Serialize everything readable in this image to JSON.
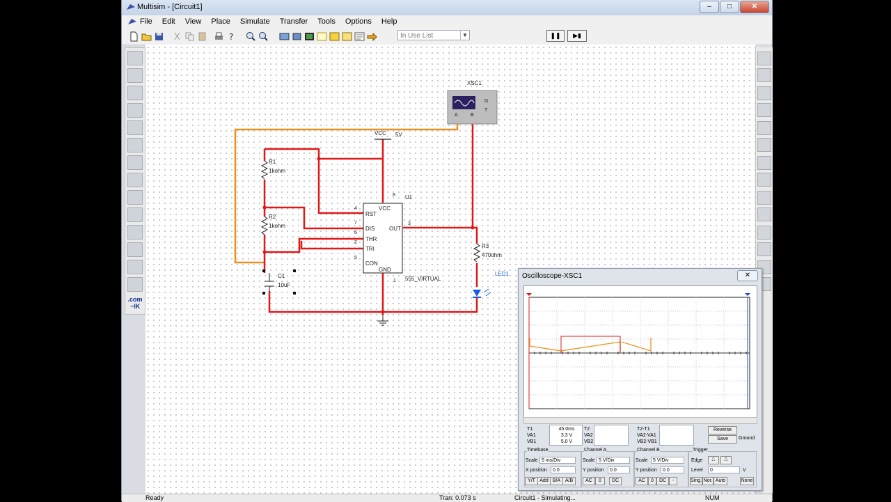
{
  "window": {
    "title": "Multisim - [Circuit1]",
    "buttons": [
      "–",
      "□",
      "✕"
    ]
  },
  "menu": [
    "File",
    "Edit",
    "View",
    "Place",
    "Simulate",
    "Transfer",
    "Tools",
    "Options",
    "Help"
  ],
  "toolbar": {
    "in_use_list": "In Use List"
  },
  "canvas": {
    "labels": {
      "xsc1": "XSC1",
      "vcc": "VCC",
      "vcc_val": "5V",
      "r1": "R1",
      "r1_val": "1kohm",
      "r2": "R2",
      "r2_val": "1kohm",
      "r3": "R3",
      "r3_val": "470ohm",
      "c1": "C1",
      "c1_val": "10uF",
      "u1": "U1",
      "u1_part": "555_VIRTUAL",
      "led1": "LED1",
      "pin_rst": "RST",
      "pin_dis": "DIS",
      "pin_thr": "THR",
      "pin_tri": "TRI",
      "pin_con": "CON",
      "pin_vcc": "VCC",
      "pin_out": "OUT",
      "pin_gnd": "GND",
      "pin4": "4",
      "pin7": "7",
      "pin6": "6",
      "pin2": "2",
      "pin5": "5",
      "pin8": "8",
      "pin3": "3",
      "pin1": "1",
      "scope_a": "A",
      "scope_b": "B",
      "scope_g": "G",
      "scope_t": "T"
    }
  },
  "oscilloscope": {
    "title": "Oscilloscope-XSC1",
    "close": "✕",
    "readout": {
      "t1": "T1",
      "va1": "VA1",
      "vb1": "VB1",
      "t1_time": "45.0ms",
      "t1_va": "3.3 V",
      "t1_vb": "5.0 V",
      "t2": "T2",
      "va2": "VA2",
      "vb2": "VB2",
      "t2t1": "T2-T1",
      "va2va1": "VA2-VA1",
      "vb2vb1": "VB2-VB1",
      "reverse": "Reverse",
      "save": "Save",
      "ground": "Ground"
    },
    "timebase": {
      "label": "Timebase",
      "scale_label": "Scale",
      "scale": "5 ms/Div",
      "xpos_label": "X position",
      "xpos": "0.0",
      "buttons": [
        "Y/T",
        "Add",
        "B/A",
        "A/B"
      ]
    },
    "channel_a": {
      "label": "Channel A",
      "scale_label": "Scale",
      "scale": "5 V/Div",
      "ypos_label": "Y position",
      "ypos": "0.0",
      "buttons": [
        "AC",
        "0",
        "DC"
      ]
    },
    "channel_b": {
      "label": "Channel B",
      "scale_label": "Scale",
      "scale": "5 V/Div",
      "ypos_label": "Y position",
      "ypos": "0.0",
      "buttons": [
        "AC",
        "0",
        "DC",
        "-"
      ]
    },
    "trigger": {
      "label": "Trigger",
      "edge_label": "Edge",
      "level_label": "Level",
      "level": "0",
      "level_unit": "V",
      "buttons": [
        "Sing.",
        "Nor.",
        "Auto",
        "None"
      ]
    }
  },
  "status": {
    "ready": "Ready",
    "tran": "Tran: 0.073 s",
    "sim": "Circuit1 - Simulating...",
    "num": "NUM"
  }
}
